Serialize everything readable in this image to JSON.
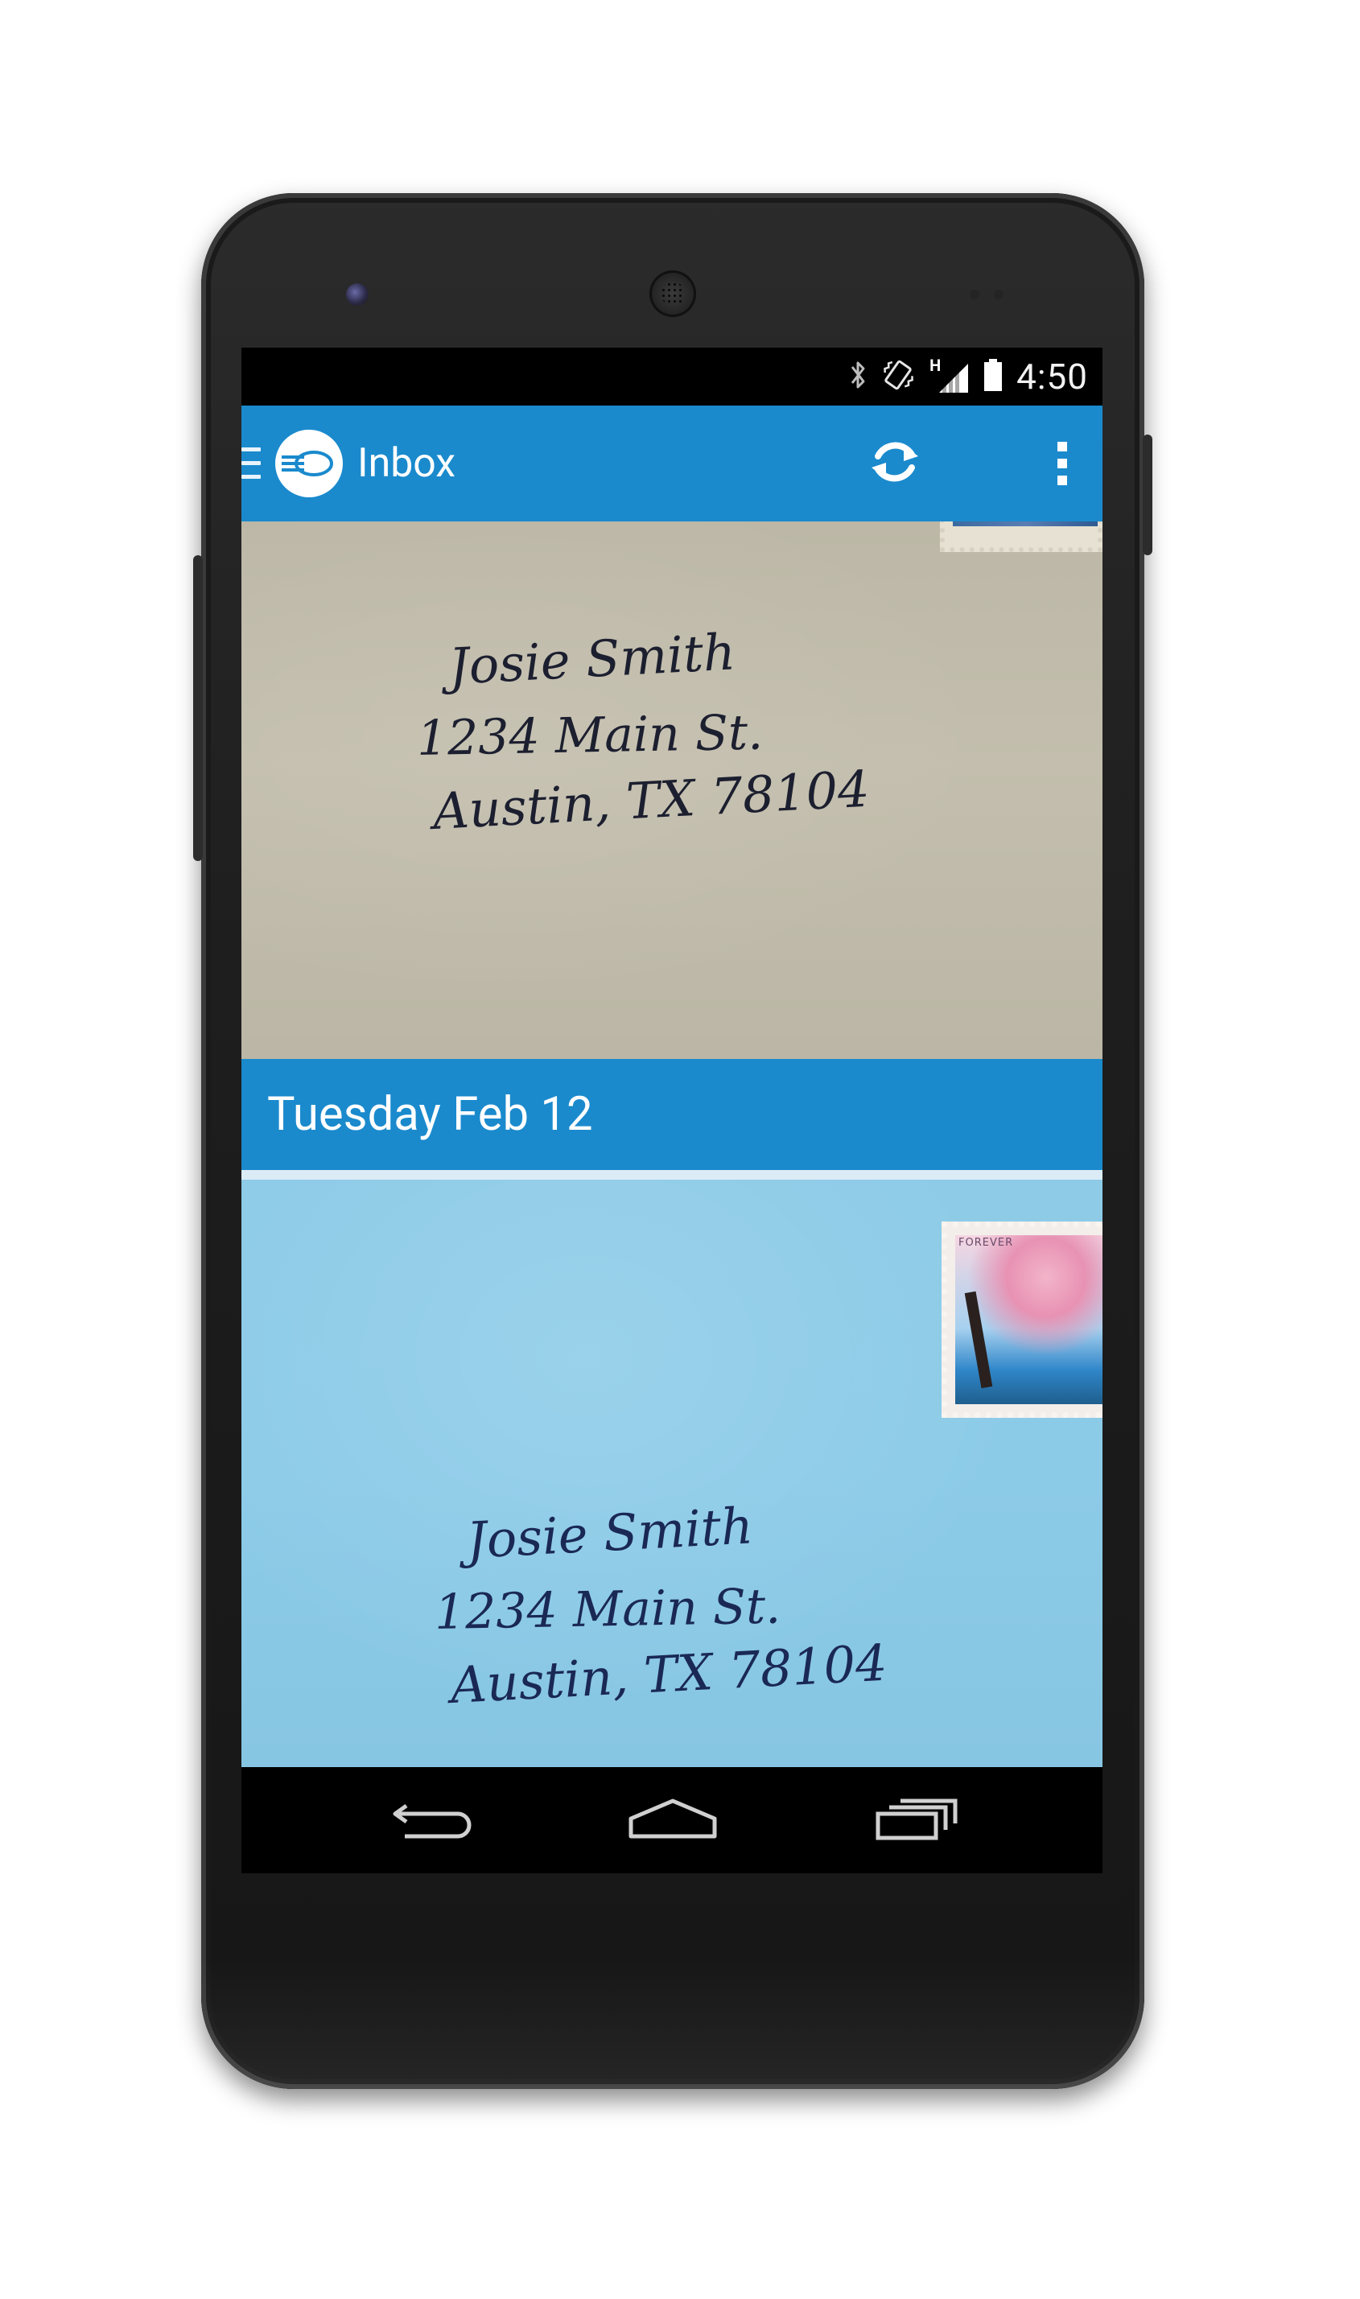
{
  "status_bar": {
    "time": "4:50",
    "network_type": "H",
    "icons": [
      "bluetooth-icon",
      "vibrate-icon",
      "signal-icon",
      "battery-icon"
    ]
  },
  "action_bar": {
    "title": "Inbox",
    "icons": [
      "drawer-icon",
      "app-logo-icon",
      "refresh-icon",
      "overflow-menu-icon"
    ]
  },
  "inbox": {
    "items": [
      {
        "type": "envelope",
        "color": "#c0bbab",
        "address": {
          "name": "Josie Smith",
          "street": "1234 Main St.",
          "city": "Austin, TX 78104"
        }
      },
      {
        "type": "date_header",
        "label": "Tuesday Feb 12"
      },
      {
        "type": "envelope",
        "color": "#8ccae7",
        "stamp_text": "FOREVER",
        "address": {
          "name": "Josie Smith",
          "street": "1234 Main St.",
          "city": "Austin, TX 78104"
        }
      }
    ]
  },
  "nav_bar": {
    "icons": [
      "back-icon",
      "home-icon",
      "recent-apps-icon"
    ]
  },
  "colors": {
    "accent": "#1a8acd",
    "status_bar": "#000000",
    "nav_bar": "#000000"
  }
}
